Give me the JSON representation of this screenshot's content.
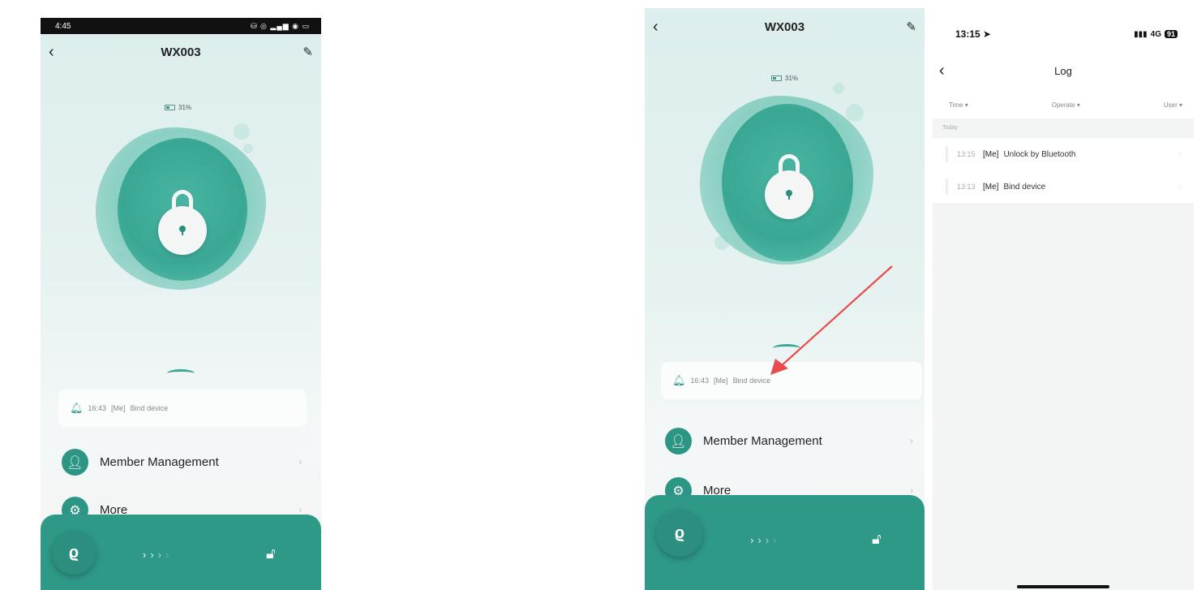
{
  "phone1": {
    "status_time": "4:45",
    "status_icons": "⛁ ◎ ▂▄▆ ◉ ▭",
    "title": "WX003",
    "battery": "31%",
    "last_log": {
      "time": "16:43",
      "user": "[Me]",
      "action": "Bind device"
    },
    "menu": [
      {
        "label": "Member Management"
      },
      {
        "label": "More"
      }
    ]
  },
  "phone2": {
    "title": "WX003",
    "battery": "31%",
    "last_log": {
      "time": "16:43",
      "user": "[Me]",
      "action": "Bind device"
    },
    "menu": [
      {
        "label": "Member Management"
      },
      {
        "label": "More"
      }
    ]
  },
  "phone3": {
    "status_time": "13:15",
    "network": "4G",
    "battery_badge": "91",
    "title": "Log",
    "filters": [
      "Time",
      "Operate",
      "User"
    ],
    "section": "Today",
    "entries": [
      {
        "time": "13:15",
        "user": "[Me]",
        "action": "Unlock by Bluetooth"
      },
      {
        "time": "13:13",
        "user": "[Me]",
        "action": "Bind device"
      }
    ]
  },
  "colors": {
    "accent": "#2e9987",
    "arrow": "#e84c4c"
  },
  "icons": [
    "back-icon",
    "edit-icon",
    "battery-icon",
    "lock-icon",
    "bell-icon",
    "person-icon",
    "gear-icon",
    "key-icon",
    "unlock-icon",
    "chevron-right-icon"
  ]
}
